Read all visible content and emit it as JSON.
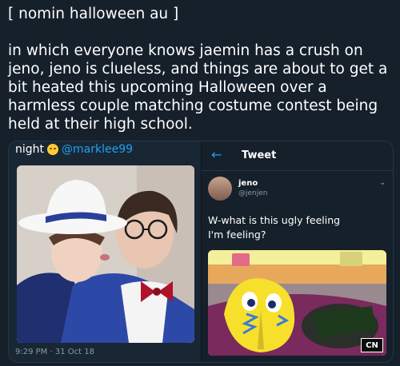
{
  "post": {
    "text": "[ nomin halloween au ]\n\nin which everyone knows jaemin has a crush on jeno, jeno is clueless, and things are about to get a bit heated this upcoming Halloween over a harmless couple matching costume contest being held at their high school."
  },
  "left_screenshot": {
    "caption": "night",
    "mention": "@marklee99",
    "timestamp": "9:29 PM · 31 Oct 18"
  },
  "right_screenshot": {
    "header_title": "Tweet",
    "user_name": "jeno",
    "user_handle": "@jenjen",
    "body": "W-what is this ugly feeling\nI'm feeling?",
    "watermark": "CN"
  },
  "icons": {
    "back": "back-arrow-icon",
    "caret": "chevron-down-icon",
    "emoji": "smiling-emoji-icon"
  }
}
